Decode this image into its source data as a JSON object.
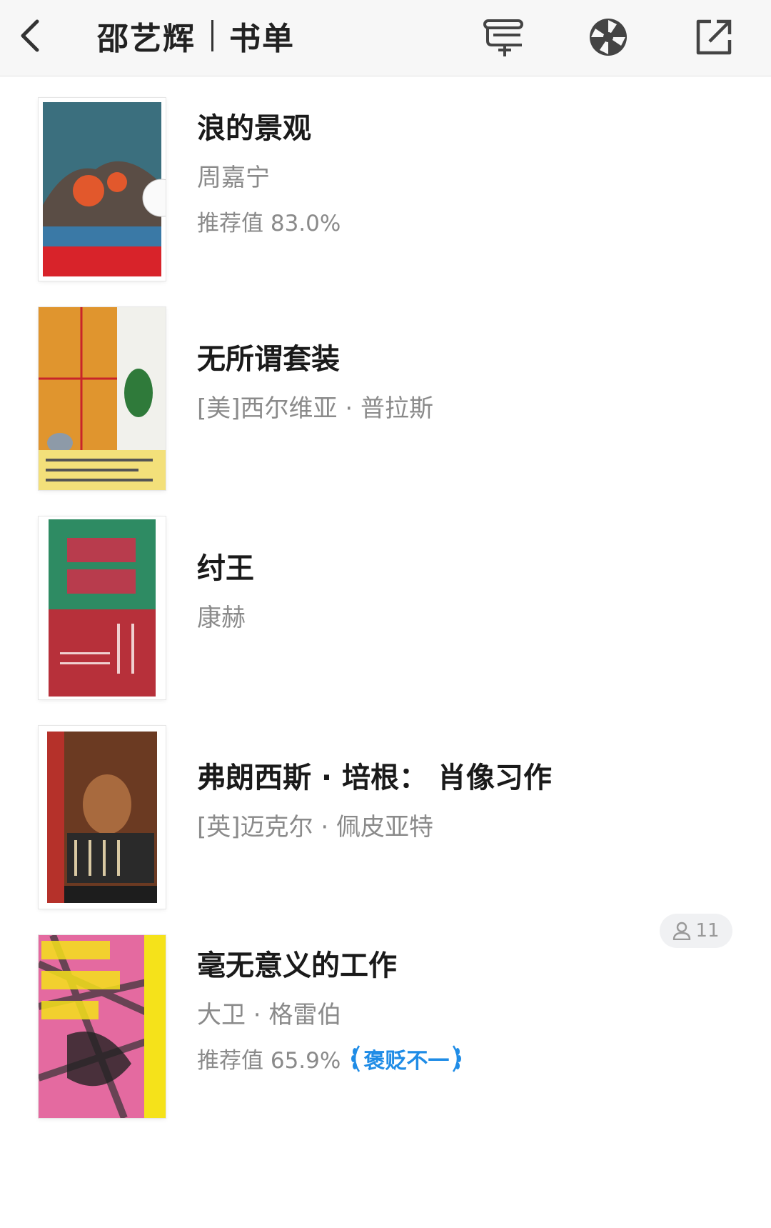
{
  "header": {
    "title_name": "邵艺辉",
    "title_list": "书单",
    "icons": [
      "back-icon",
      "add-to-shelf-icon",
      "aperture-icon",
      "share-icon"
    ]
  },
  "books": [
    {
      "title": "浪的景观",
      "author": "周嘉宁",
      "score": "推荐值 83.0%",
      "cover": {
        "accent": "#3b6f7e",
        "band": "#d8232a",
        "art": "#e2582c"
      }
    },
    {
      "title": "无所谓套装",
      "author": "[美]西尔维亚 · 普拉斯",
      "score": "",
      "cover": {
        "accent": "#e0952e",
        "band": "#f3e07a",
        "art": "#2f7a3a"
      }
    },
    {
      "title": "纣王",
      "author": "康赫",
      "score": "",
      "cover": {
        "accent": "#2e8b63",
        "band": "#b7303a",
        "art": "#c8334a"
      }
    },
    {
      "title": "弗朗西斯 · 培根： 肖像习作",
      "author": "[英]迈克尔 · 佩皮亚特",
      "score": "",
      "cover": {
        "accent": "#b5312a",
        "band": "#2a2a2a",
        "art": "#d9c9a3"
      }
    },
    {
      "title": "毫无意义的工作",
      "author": "大卫 · 格雷伯",
      "score": "推荐值 65.9%",
      "badge": "褒贬不一",
      "readers": "11",
      "cover": {
        "accent": "#e46aa0",
        "band": "#f5e21a",
        "art": "#222222"
      }
    }
  ],
  "colors": {
    "accent_blue": "#1f8ce6",
    "text_primary": "#1a1a1a",
    "text_secondary": "#8a8a8a"
  }
}
